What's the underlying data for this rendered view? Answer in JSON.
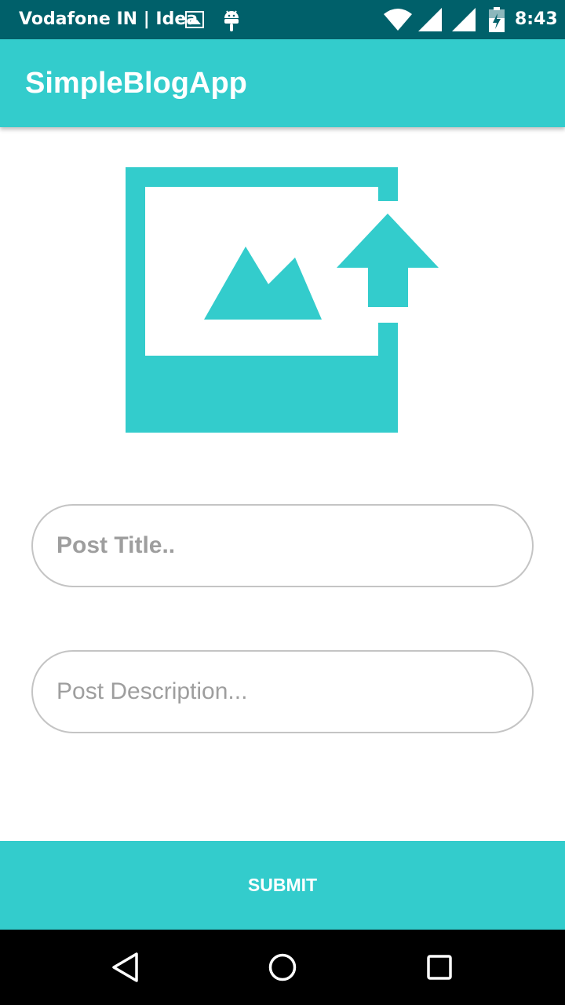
{
  "status_bar": {
    "carrier": "Vodafone IN | Idea",
    "time": "8:43",
    "icons": [
      "image-icon",
      "android-icon",
      "wifi-icon",
      "signal-icon",
      "signal-icon",
      "battery-icon"
    ]
  },
  "app_bar": {
    "title": "SimpleBlogApp"
  },
  "upload": {
    "icon": "add-photo-upload-icon",
    "color": "#33cccc"
  },
  "form": {
    "title_placeholder": "Post Title..",
    "title_value": "",
    "description_placeholder": "Post Description...",
    "description_value": ""
  },
  "submit": {
    "label": "SUBMIT"
  },
  "nav_bar": {
    "icons": [
      "back-icon",
      "home-icon",
      "recents-icon"
    ]
  },
  "colors": {
    "primary": "#33cccc",
    "status_bar": "#00606a",
    "field_border": "#c4c4c4",
    "hint_text": "#9e9e9e"
  }
}
